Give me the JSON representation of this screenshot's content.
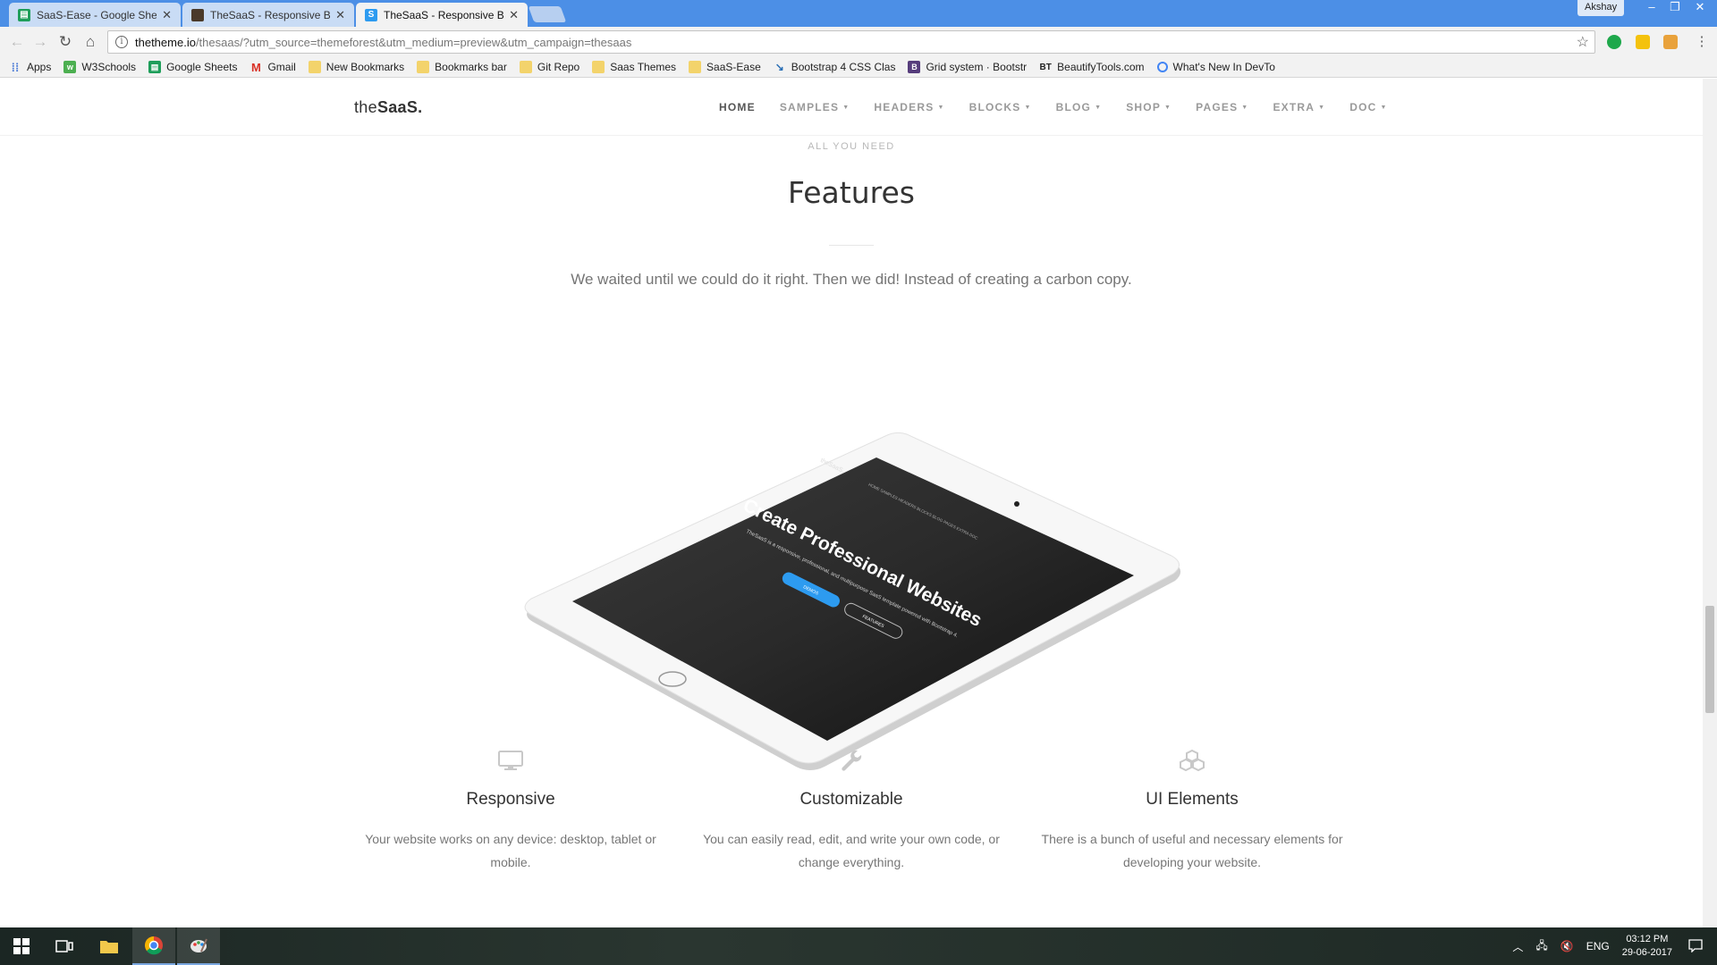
{
  "browser": {
    "tabs": [
      {
        "title": "SaaS-Ease - Google Shee",
        "favicon": "google-sheets-icon",
        "active": false
      },
      {
        "title": "TheSaaS - Responsive Bo",
        "favicon": "thesaas-dark-icon",
        "active": false
      },
      {
        "title": "TheSaaS - Responsive Bo",
        "favicon": "s-blue-icon",
        "active": true
      }
    ],
    "profile": "Akshay",
    "url_host": "thetheme.io",
    "url_rest": "/thesaas/?utm_source=themeforest&utm_medium=preview&utm_campaign=thesaas",
    "bookmarks": [
      {
        "label": "Apps",
        "icon": "apps-grid-icon"
      },
      {
        "label": "W3Schools",
        "icon": "w3schools-icon"
      },
      {
        "label": "Google Sheets",
        "icon": "google-sheets-icon"
      },
      {
        "label": "Gmail",
        "icon": "gmail-icon"
      },
      {
        "label": "New Bookmarks",
        "icon": "folder-icon"
      },
      {
        "label": "Bookmarks bar",
        "icon": "folder-icon"
      },
      {
        "label": "Git Repo",
        "icon": "folder-icon"
      },
      {
        "label": "Saas Themes",
        "icon": "folder-icon"
      },
      {
        "label": "SaaS-Ease",
        "icon": "folder-icon"
      },
      {
        "label": "Bootstrap 4 CSS Clas",
        "icon": "bootstrap-icon"
      },
      {
        "label": "Grid system · Bootstr",
        "icon": "bootstrap-b-icon"
      },
      {
        "label": "BeautifyTools.com",
        "icon": "bt-icon"
      },
      {
        "label": "What's New In DevTo",
        "icon": "chrome-icon"
      }
    ]
  },
  "site": {
    "logo_light": "the",
    "logo_bold": "SaaS.",
    "menu": [
      {
        "label": "HOME",
        "active": true,
        "caret": false
      },
      {
        "label": "SAMPLES",
        "active": false,
        "caret": true
      },
      {
        "label": "HEADERS",
        "active": false,
        "caret": true
      },
      {
        "label": "BLOCKS",
        "active": false,
        "caret": true
      },
      {
        "label": "BLOG",
        "active": false,
        "caret": true
      },
      {
        "label": "SHOP",
        "active": false,
        "caret": true
      },
      {
        "label": "PAGES",
        "active": false,
        "caret": true
      },
      {
        "label": "EXTRA",
        "active": false,
        "caret": true
      },
      {
        "label": "DOC",
        "active": false,
        "caret": true
      }
    ]
  },
  "section": {
    "kicker": "ALL YOU NEED",
    "title": "Features",
    "lead": "We waited until we could do it right. Then we did! Instead of creating a carbon copy."
  },
  "tablet_screen": {
    "logo": "theSaaS.",
    "nav": "HOME   SAMPLES   HEADERS   BLOCKS   BLOG   PAGES   EXTRA   DOC",
    "headline": "Create Professional Websites",
    "subtext": "TheSaaS is a responsive, professional, and multipurpose SaaS template powered with Bootstrap 4.",
    "primary_button": "DEMOS",
    "secondary_button": "FEATURES"
  },
  "features": [
    {
      "icon": "monitor-icon",
      "title": "Responsive",
      "desc": "Your website works on any device: desktop, tablet or mobile."
    },
    {
      "icon": "wrench-icon",
      "title": "Customizable",
      "desc": "You can easily read, edit, and write your own code, or change everything."
    },
    {
      "icon": "cubes-icon",
      "title": "UI Elements",
      "desc": "There is a bunch of useful and necessary elements for developing your website."
    }
  ],
  "features_partial": [
    {
      "icon": "code-icon"
    },
    {
      "icon": "document-icon"
    },
    {
      "icon": "download-icon"
    }
  ],
  "taskbar": {
    "language": "ENG",
    "time": "03:12 PM",
    "date": "29-06-2017"
  },
  "colors": {
    "chrome_tabstrip": "#4c8fe6",
    "accent_blue": "#2d9bf0",
    "taskbar": "#1f2a26"
  }
}
